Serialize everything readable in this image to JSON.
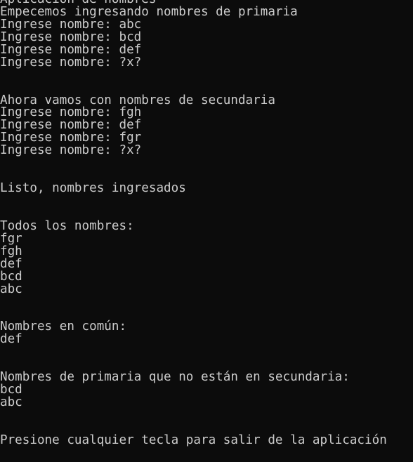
{
  "console": {
    "background_color": "#0c0c0c",
    "text_color": "#cccccc",
    "lines": [
      "Aplicación de nombres",
      "Empecemos ingresando nombres de primaria",
      "Ingrese nombre: abc",
      "Ingrese nombre: bcd",
      "Ingrese nombre: def",
      "Ingrese nombre: ?x?",
      "",
      "",
      "Ahora vamos con nombres de secundaria",
      "Ingrese nombre: fgh",
      "Ingrese nombre: def",
      "Ingrese nombre: fgr",
      "Ingrese nombre: ?x?",
      "",
      "",
      "Listo, nombres ingresados",
      "",
      "",
      "Todos los nombres:",
      "fgr",
      "fgh",
      "def",
      "bcd",
      "abc",
      "",
      "",
      "Nombres en común:",
      "def",
      "",
      "",
      "Nombres de primaria que no están en secundaria:",
      "bcd",
      "abc",
      "",
      "",
      "Presione cualquier tecla para salir de la aplicación"
    ]
  }
}
